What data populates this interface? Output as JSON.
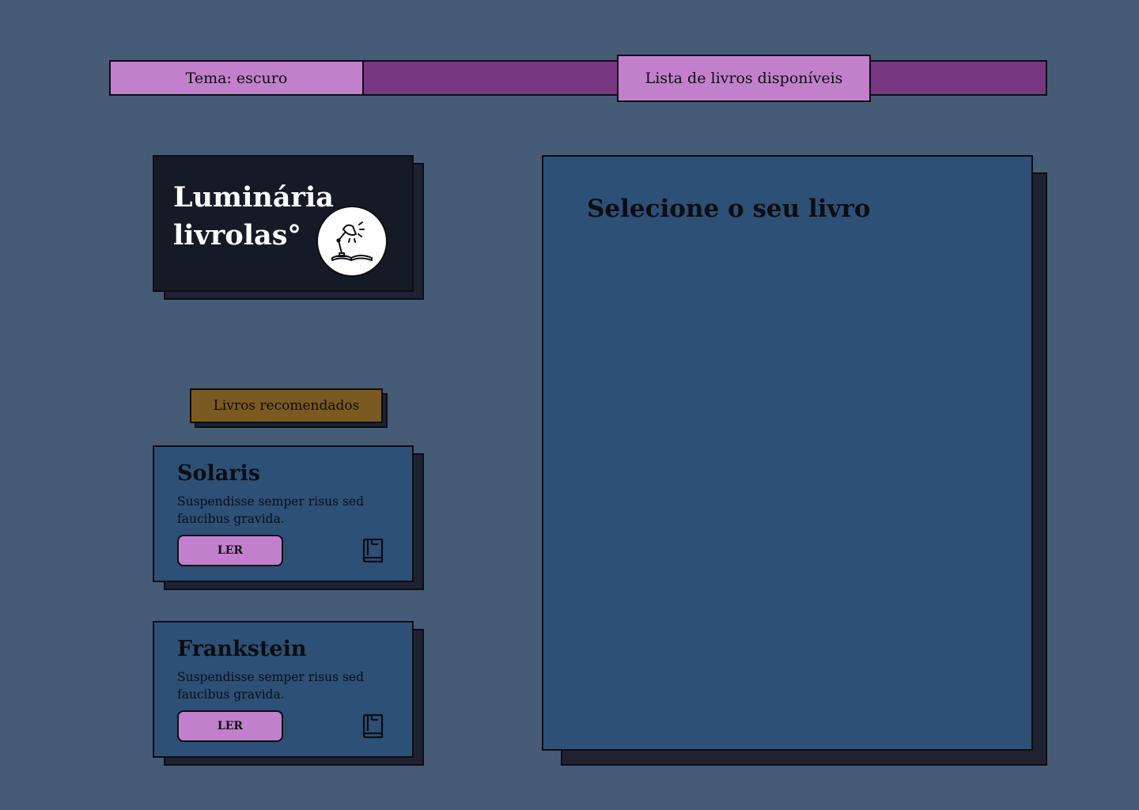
{
  "nav": {
    "theme_label": "Tema: escuro",
    "books_label": "Lista de livros disponíveis"
  },
  "logo": {
    "line1": "Luminária",
    "line2": "livrolas°",
    "icon": "desk-lamp-icon"
  },
  "recommended": {
    "label": "Livros recomendados",
    "books": [
      {
        "title": "Solaris",
        "description": "Suspendisse semper risus sed faucibus gravida.",
        "button": "LER",
        "icon": "book-icon"
      },
      {
        "title": "Frankstein",
        "description": "Suspendisse semper risus sed faucibus gravida.",
        "button": "LER",
        "icon": "book-icon"
      }
    ]
  },
  "main": {
    "title": "Selecione o seu livro"
  },
  "colors": {
    "background": "#465b76",
    "accent_light": "#c280cc",
    "accent_dark": "#773782",
    "card_blue": "#2d5077",
    "logo_bg": "#151b26",
    "label_gold": "#7a5a21",
    "shadow": "#1e2232"
  }
}
